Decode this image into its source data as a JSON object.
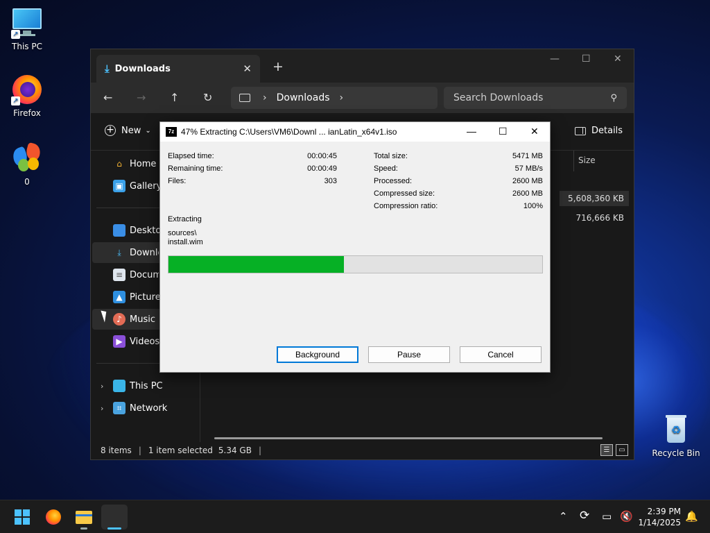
{
  "desktop": {
    "icons": [
      {
        "label": "This PC"
      },
      {
        "label": "Firefox"
      },
      {
        "label": "0"
      },
      {
        "label": "Recycle Bin"
      }
    ]
  },
  "explorer": {
    "tab_title": "Downloads",
    "breadcrumb": "Downloads",
    "search_placeholder": "Search Downloads",
    "new_label": "New",
    "details_label": "Details",
    "sidebar": {
      "home": "Home",
      "gallery": "Gallery",
      "desktop": "Desktop",
      "downloads": "Downloads",
      "documents": "Documents",
      "pictures": "Pictures",
      "music": "Music",
      "videos": "Videos",
      "this_pc": "This PC",
      "network": "Network"
    },
    "column_size": "Size",
    "sizes": [
      "5,608,360 KB",
      "716,666 KB"
    ],
    "status": {
      "items": "8 items",
      "selected": "1 item selected",
      "selected_size": "5.34 GB"
    }
  },
  "sevenzip": {
    "logo": "7z",
    "title": "47% Extracting C:\\Users\\VM6\\Downl ... ianLatin_x64v1.iso",
    "left_stats": [
      {
        "label": "Elapsed time:",
        "value": "00:00:45"
      },
      {
        "label": "Remaining time:",
        "value": "00:00:49"
      },
      {
        "label": "Files:",
        "value": "303"
      }
    ],
    "right_stats": [
      {
        "label": "Total size:",
        "value": "5471 MB"
      },
      {
        "label": "Speed:",
        "value": "57 MB/s"
      },
      {
        "label": "Processed:",
        "value": "2600 MB"
      },
      {
        "label": "Compressed size:",
        "value": "2600 MB"
      },
      {
        "label": "Compression ratio:",
        "value": "100%"
      }
    ],
    "operation": "Extracting",
    "current_dir": "sources\\",
    "current_file": "install.wim",
    "progress_percent": 47,
    "buttons": {
      "background": "Background",
      "pause": "Pause",
      "cancel": "Cancel"
    },
    "progress_color": "#06b025"
  },
  "taskbar": {
    "time": "2:39 PM",
    "date": "1/14/2025"
  }
}
